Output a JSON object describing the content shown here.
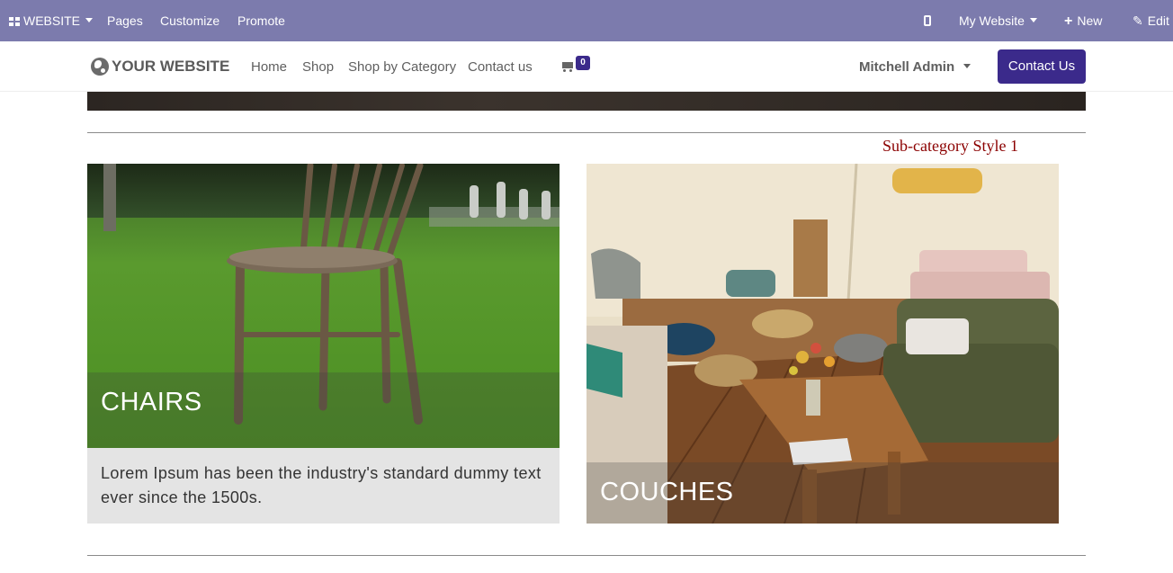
{
  "admin_bar": {
    "website_label": "WEBSITE",
    "pages_label": "Pages",
    "customize_label": "Customize",
    "promote_label": "Promote",
    "my_website_label": "My Website",
    "new_label": "New",
    "edit_label": "Edit"
  },
  "header": {
    "logo_text": "YOUR WEBSITE",
    "nav": [
      "Home",
      "Shop",
      "Shop by Category",
      "Contact us"
    ],
    "cart_count": "0",
    "user_name": "Mitchell Admin",
    "contact_button": "Contact Us"
  },
  "section": {
    "title": "Sub-category Style 1"
  },
  "categories": [
    {
      "name": "CHAIRS",
      "description": "Lorem Ipsum has been the industry's standard dummy text ever since the 1500s."
    },
    {
      "name": "COUCHES"
    }
  ],
  "colors": {
    "admin_bar": "#7c7bad",
    "brand": "#3b2a8b",
    "section_title": "#8b0000"
  }
}
